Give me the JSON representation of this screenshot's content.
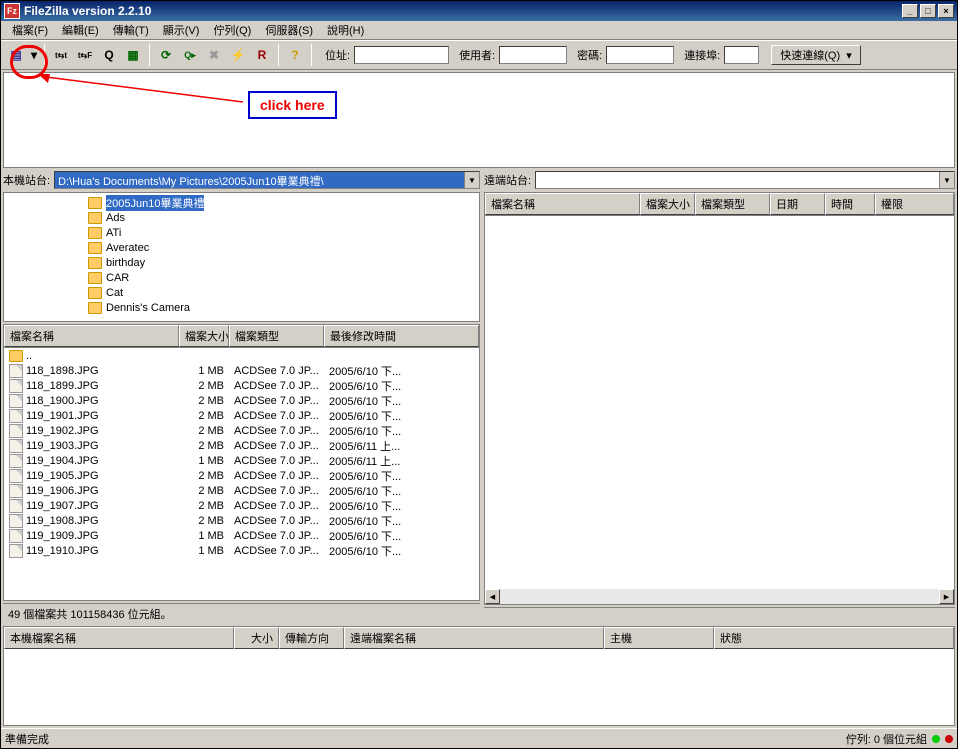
{
  "title": "FileZilla version 2.2.10",
  "menu": {
    "file": "檔案(F)",
    "edit": "編輯(E)",
    "transfer": "傳輸(T)",
    "view": "顯示(V)",
    "queue": "佇列(Q)",
    "server": "伺服器(S)",
    "help": "說明(H)"
  },
  "toolbar": {
    "address_label": "位址:",
    "user_label": "使用者:",
    "pass_label": "密碼:",
    "port_label": "連接埠:",
    "quickconnect": "快速連線(Q)"
  },
  "annotation": {
    "click_here": "click here"
  },
  "local": {
    "site_label": "本機站台:",
    "path": "D:\\Hua's Documents\\My Pictures\\2005Jun10畢業典禮\\",
    "folders": [
      {
        "name": "2005Jun10畢業典禮",
        "sel": true
      },
      {
        "name": "Ads"
      },
      {
        "name": "ATi"
      },
      {
        "name": "Averatec"
      },
      {
        "name": "birthday"
      },
      {
        "name": "CAR"
      },
      {
        "name": "Cat"
      },
      {
        "name": "Dennis's Camera"
      }
    ],
    "cols": {
      "name": "檔案名稱",
      "size": "檔案大小",
      "type": "檔案類型",
      "mod": "最後修改時間"
    },
    "files": [
      {
        "name": "..",
        "size": "",
        "type": "",
        "mod": ""
      },
      {
        "name": "118_1898.JPG",
        "size": "1 MB",
        "type": "ACDSee 7.0 JP...",
        "mod": "2005/6/10 下..."
      },
      {
        "name": "118_1899.JPG",
        "size": "2 MB",
        "type": "ACDSee 7.0 JP...",
        "mod": "2005/6/10 下..."
      },
      {
        "name": "118_1900.JPG",
        "size": "2 MB",
        "type": "ACDSee 7.0 JP...",
        "mod": "2005/6/10 下..."
      },
      {
        "name": "119_1901.JPG",
        "size": "2 MB",
        "type": "ACDSee 7.0 JP...",
        "mod": "2005/6/10 下..."
      },
      {
        "name": "119_1902.JPG",
        "size": "2 MB",
        "type": "ACDSee 7.0 JP...",
        "mod": "2005/6/10 下..."
      },
      {
        "name": "119_1903.JPG",
        "size": "2 MB",
        "type": "ACDSee 7.0 JP...",
        "mod": "2005/6/11 上..."
      },
      {
        "name": "119_1904.JPG",
        "size": "1 MB",
        "type": "ACDSee 7.0 JP...",
        "mod": "2005/6/11 上..."
      },
      {
        "name": "119_1905.JPG",
        "size": "2 MB",
        "type": "ACDSee 7.0 JP...",
        "mod": "2005/6/10 下..."
      },
      {
        "name": "119_1906.JPG",
        "size": "2 MB",
        "type": "ACDSee 7.0 JP...",
        "mod": "2005/6/10 下..."
      },
      {
        "name": "119_1907.JPG",
        "size": "2 MB",
        "type": "ACDSee 7.0 JP...",
        "mod": "2005/6/10 下..."
      },
      {
        "name": "119_1908.JPG",
        "size": "2 MB",
        "type": "ACDSee 7.0 JP...",
        "mod": "2005/6/10 下..."
      },
      {
        "name": "119_1909.JPG",
        "size": "1 MB",
        "type": "ACDSee 7.0 JP...",
        "mod": "2005/6/10 下..."
      },
      {
        "name": "119_1910.JPG",
        "size": "1 MB",
        "type": "ACDSee 7.0 JP...",
        "mod": "2005/6/10 下..."
      }
    ],
    "status": "49 個檔案共 101158436 位元組。"
  },
  "remote": {
    "site_label": "遠端站台:",
    "cols": {
      "name": "檔案名稱",
      "size": "檔案大小",
      "type": "檔案類型",
      "date": "日期",
      "time": "時間",
      "perm": "權限"
    }
  },
  "queue": {
    "cols": {
      "localfile": "本機檔案名稱",
      "size": "大小",
      "direction": "傳輸方向",
      "remotefile": "遠端檔案名稱",
      "host": "主機",
      "status": "狀態"
    }
  },
  "statusbar": {
    "ready": "準備完成",
    "queue": "佇列: 0 個位元組"
  }
}
